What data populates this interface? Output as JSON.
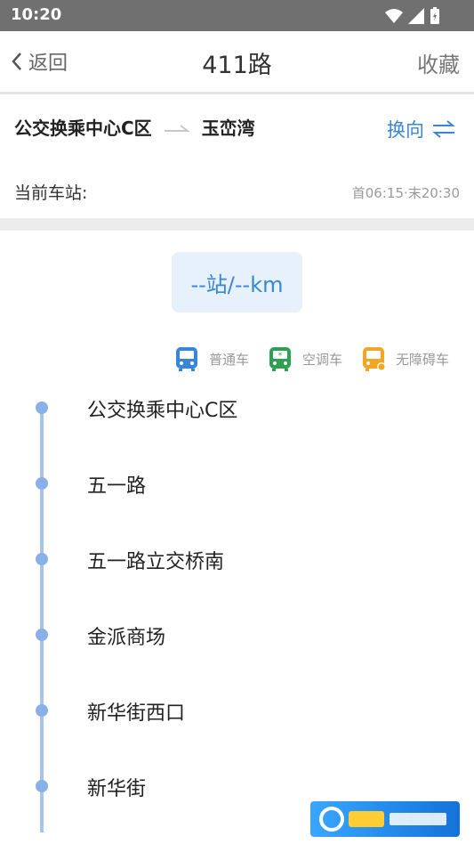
{
  "status_bar": {
    "time": "10:20"
  },
  "nav": {
    "back_label": "返回",
    "title": "411路",
    "favorite_label": "收藏"
  },
  "route": {
    "from": "公交换乘中心C区",
    "to": "玉峦湾",
    "swap_label": "换向"
  },
  "info": {
    "current_station_label": "当前车站:",
    "schedule": "首06:15·末20:30"
  },
  "summary": {
    "text": "--站/--km"
  },
  "legend": [
    {
      "label": "普通车",
      "icon": "bus-icon",
      "color": "#3a86d6"
    },
    {
      "label": "空调车",
      "icon": "ac-bus-icon",
      "color": "#2ea052"
    },
    {
      "label": "无障碍车",
      "icon": "accessible-bus-icon",
      "color": "#f2a623"
    }
  ],
  "stops": [
    "公交换乘中心C区",
    "五一路",
    "五一路立交桥南",
    "金派商场",
    "新华街西口",
    "新华街"
  ]
}
